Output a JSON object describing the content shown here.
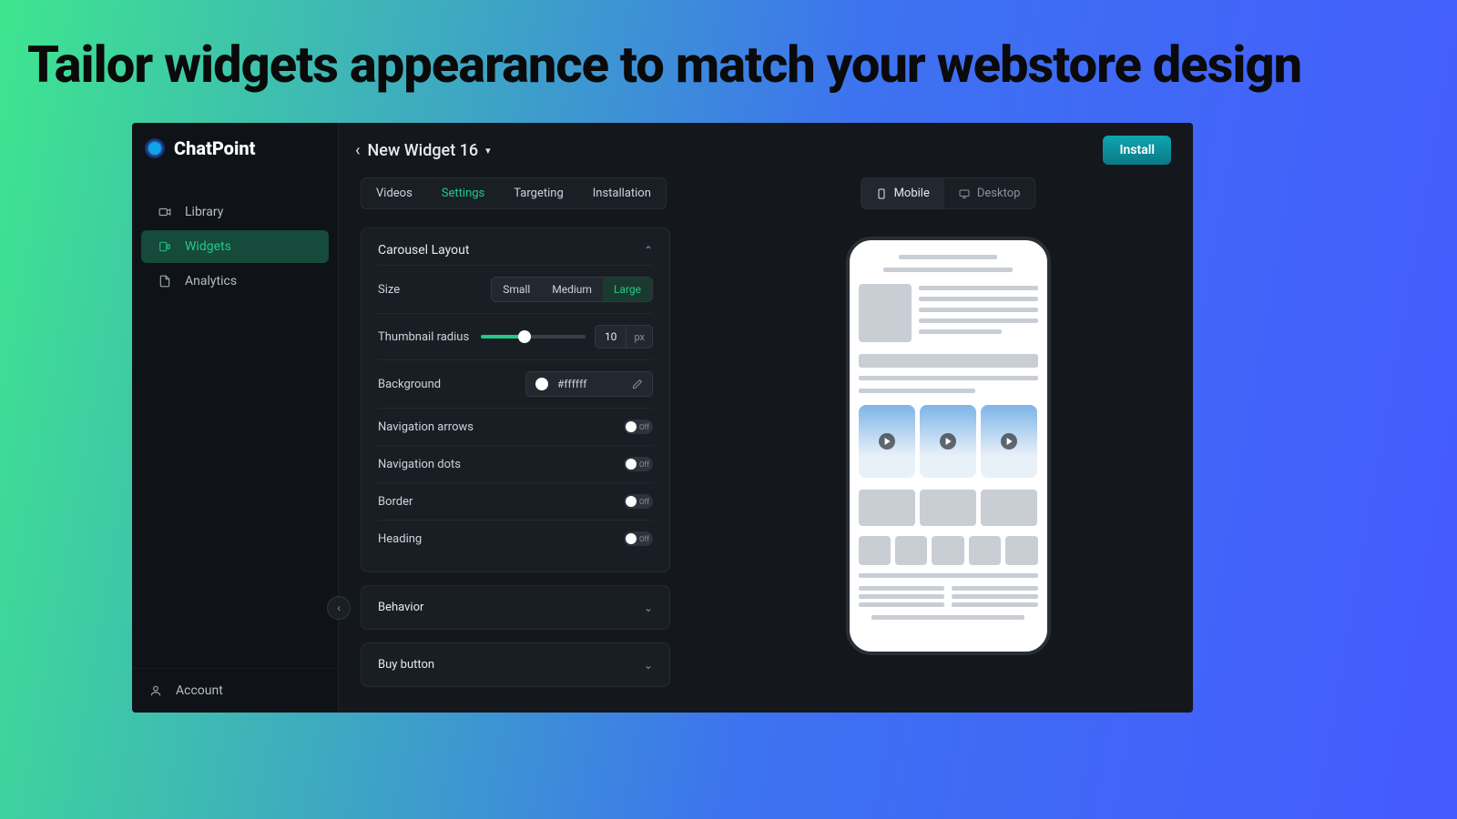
{
  "hero": {
    "title": "Tailor widgets appearance to match your webstore design"
  },
  "brand": {
    "name": "ChatPoint"
  },
  "sidebar": {
    "items": [
      {
        "label": "Library"
      },
      {
        "label": "Widgets"
      },
      {
        "label": "Analytics"
      }
    ],
    "account": "Account"
  },
  "header": {
    "breadcrumb": "New Widget 16",
    "install": "Install"
  },
  "tabs": {
    "videos": "Videos",
    "settings": "Settings",
    "targeting": "Targeting",
    "installation": "Installation"
  },
  "panel": {
    "carousel_title": "Carousel Layout",
    "size_label": "Size",
    "size_options": {
      "small": "Small",
      "medium": "Medium",
      "large": "Large"
    },
    "thumb_radius_label": "Thumbnail radius",
    "thumb_radius_value": "10",
    "thumb_radius_unit": "px",
    "background_label": "Background",
    "background_value": "#ffffff",
    "nav_arrows_label": "Navigation arrows",
    "nav_dots_label": "Navigation dots",
    "border_label": "Border",
    "heading_label": "Heading",
    "toggle_off": "Off",
    "behavior_title": "Behavior",
    "buy_title": "Buy button"
  },
  "preview": {
    "mobile": "Mobile",
    "desktop": "Desktop"
  }
}
